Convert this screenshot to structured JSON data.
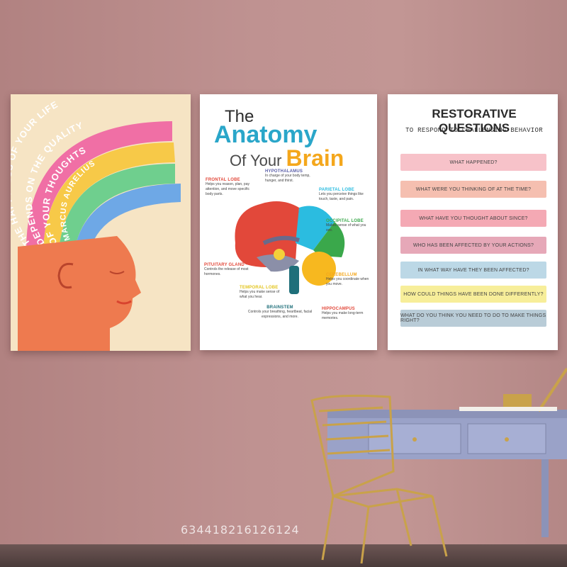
{
  "posters": {
    "happiness": {
      "line1": "THE HAPPINESS OF YOUR LIFE",
      "line2": "DEPENDS ON THE QUALITY",
      "line3": "OF YOUR THOUGHTS",
      "author": "MARCUS AURELIUS"
    },
    "brain": {
      "title_the": "The",
      "title_anatomy": "Anatomy",
      "title_of_your": "Of Your",
      "title_brain": "Brain",
      "labels": [
        {
          "head": "FRONTAL LOBE",
          "desc": "Helps you reason, plan, pay attention, and move specific body parts."
        },
        {
          "head": "HYPOTHALAMUS",
          "desc": "In charge of your body temp, hunger, and thirst."
        },
        {
          "head": "PARIETAL LOBE",
          "desc": "Lets you perceive things like touch, taste, and pain."
        },
        {
          "head": "OCCIPITAL LOBE",
          "desc": "Makes sense of what you see."
        },
        {
          "head": "PITUITARY GLAND",
          "desc": "Controls the release of most hormones."
        },
        {
          "head": "CEREBELLUM",
          "desc": "Helps you coordinate when you move."
        },
        {
          "head": "TEMPORAL LOBE",
          "desc": "Helps you make sense of what you hear."
        },
        {
          "head": "HIPPOCAMPUS",
          "desc": "Helps you make long-term memories."
        },
        {
          "head": "BRAINSTEM",
          "desc": "Controls your breathing, heartbeat, facial expressions, and more."
        }
      ]
    },
    "restorative": {
      "title": "RESTORATIVE QUESTIONS",
      "subtitle": "TO RESPOND TO CHALLENGING BEHAVIOR",
      "questions": [
        {
          "text": "WHAT HAPPENED?",
          "color": "#f7c2c9"
        },
        {
          "text": "WHAT WERE YOU THINKING OF AT THE TIME?",
          "color": "#f5bfb0"
        },
        {
          "text": "WHAT HAVE YOU THOUGHT ABOUT SINCE?",
          "color": "#f4a9b4"
        },
        {
          "text": "WHO HAS BEEN AFFECTED BY YOUR ACTIONS?",
          "color": "#e6a8b8"
        },
        {
          "text": "IN WHAT WAY HAVE THEY BEEN AFFECTED?",
          "color": "#bcd8e6"
        },
        {
          "text": "HOW COULD THINGS HAVE BEEN DONE DIFFERENTLY?",
          "color": "#f7ee9a"
        },
        {
          "text": "WHAT DO YOU THINK YOU NEED TO DO TO MAKE THINGS RIGHT?",
          "color": "#b9ccd7"
        }
      ]
    }
  },
  "watermark": "634418216126124"
}
